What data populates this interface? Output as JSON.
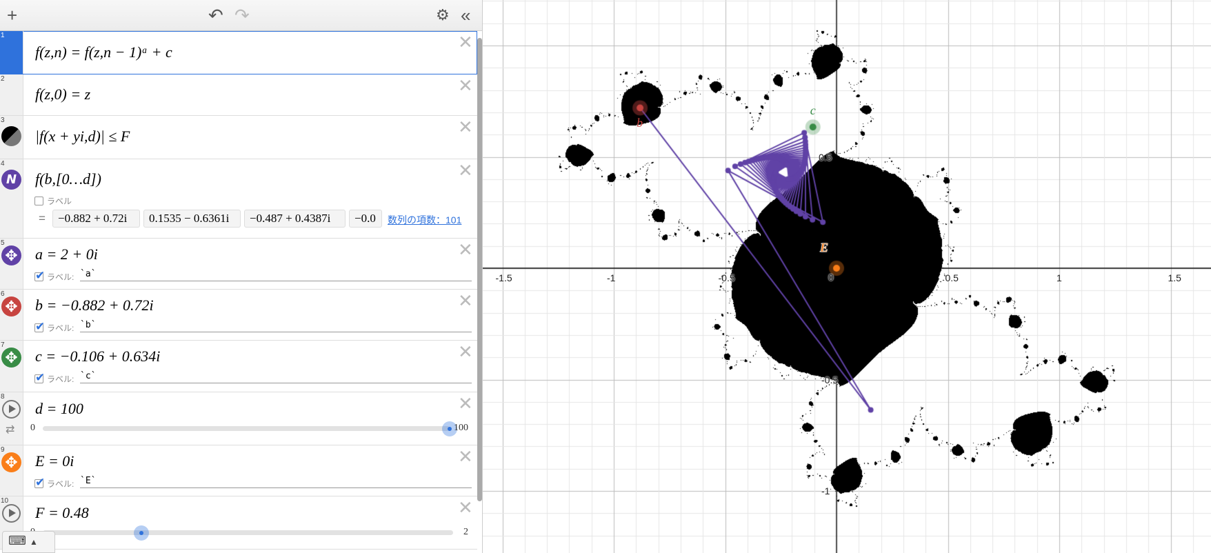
{
  "toolbar": {
    "add": "+",
    "undo": "↶",
    "redo": "↷",
    "settings": "⚙",
    "collapse": "«"
  },
  "colors": {
    "blue": "#2f72dc",
    "purple": "#6042a6",
    "red": "#c74440",
    "green": "#388c46",
    "orange": "#fa7e19",
    "black": "#000000"
  },
  "rows": [
    {
      "n": "1",
      "latex": "f(z,n) = f(z,n − 1)ᵃ + c"
    },
    {
      "n": "2",
      "latex": "f(z,0) = z"
    },
    {
      "n": "3",
      "latex": "|f(x + yi,d)| ≤ F"
    },
    {
      "n": "4",
      "latex": "f(b,[0…d])",
      "label": "ラベル",
      "eq": "=",
      "values": [
        "−0.882 + 0.72i",
        "0.1535 − 0.6361i",
        "−0.487 + 0.4387i",
        "−0.0"
      ],
      "count_link": "数列の項数：101"
    },
    {
      "n": "5",
      "latex": "a = 2 + 0i",
      "label": "ラベル:",
      "label_text": "`a`"
    },
    {
      "n": "6",
      "latex": "b = −0.882 + 0.72i",
      "label": "ラベル:",
      "label_text": "`b`"
    },
    {
      "n": "7",
      "latex": "c = −0.106 + 0.634i",
      "label": "ラベル:",
      "label_text": "`c`"
    },
    {
      "n": "8",
      "latex": "d = 100",
      "min": "0",
      "max": "100",
      "value": 100
    },
    {
      "n": "9",
      "latex": "E = 0i",
      "label": "ラベル:",
      "label_text": "`E`"
    },
    {
      "n": "10",
      "latex": "F = 0.48",
      "min": "0",
      "max": "2",
      "value": 0.48
    }
  ],
  "params": {
    "a": 2,
    "b": [
      -0.882,
      0.72
    ],
    "c": [
      -0.106,
      0.634
    ],
    "d": 100,
    "E": [
      0,
      0
    ],
    "F": 0.48
  },
  "point_labels": {
    "b": "b",
    "c": "c",
    "E": "E"
  },
  "axes": {
    "x_ticks": [
      "-1.5",
      "-1",
      "-0.5",
      "0.5",
      "1",
      "1.5"
    ],
    "x_vals": [
      -1.5,
      -1,
      -0.5,
      0.5,
      1,
      1.5
    ],
    "y_ticks": [
      "0.5",
      "-0.5",
      "-1"
    ],
    "y_vals": [
      0.5,
      -0.5,
      -1
    ],
    "origin": "0",
    "xrange": [
      -1.59,
      1.68
    ],
    "yrange": [
      -1.28,
      1.2
    ]
  }
}
